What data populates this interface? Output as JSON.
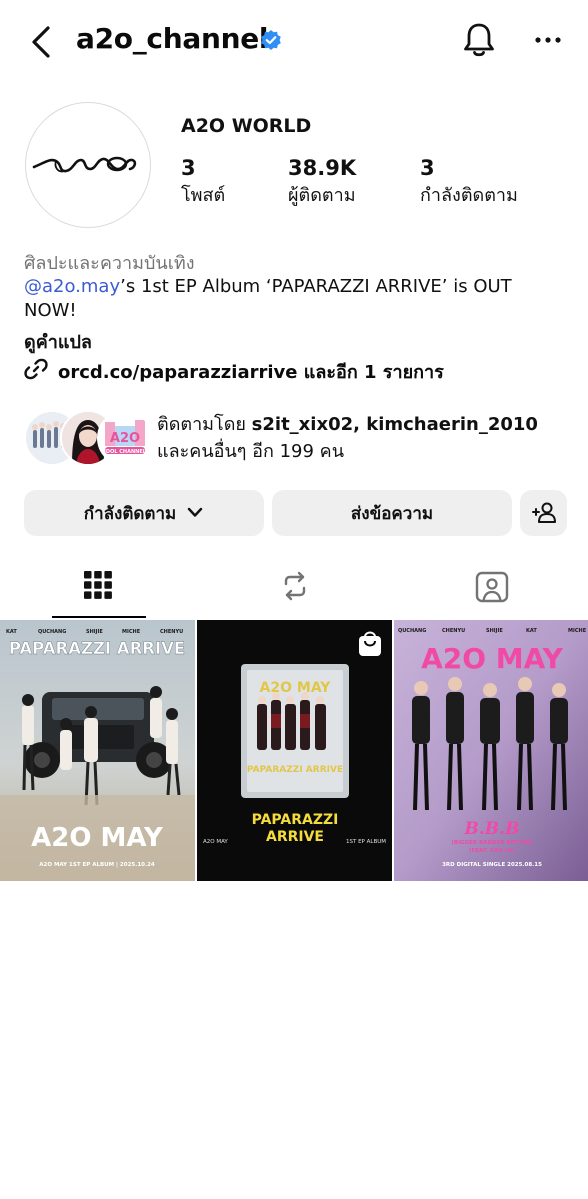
{
  "header": {
    "username": "a2o_channel",
    "back_icon": "chevron-left-icon",
    "verified_icon": "verified-badge-icon",
    "bell_icon": "bell-icon",
    "more_icon": "more-horizontal-icon"
  },
  "profile": {
    "display_name": "A2O WORLD",
    "stats": [
      {
        "value": "3",
        "label": "โพสต์"
      },
      {
        "value": "38.9K",
        "label": "ผู้ติดตาม"
      },
      {
        "value": "3",
        "label": "กำลังติดตาม"
      }
    ],
    "category": "ศิลปะและความบันเทิง",
    "bio_mention": "@a2o.may",
    "bio_text": "’s 1st EP Album ‘PAPARAZZI ARRIVE’ is OUT NOW!",
    "translate": "ดูคำแปล",
    "link": "orcd.co/paparazziarrive และอีก 1 รายการ"
  },
  "followed_by": {
    "prefix": "ติดตามโดย ",
    "names": "s2it_xix02, kimchaerin_2010",
    "suffix": "และคนอื่นๆ อีก 199 คน",
    "avatar_badge": "IDOL CHANNEL"
  },
  "actions": {
    "following_label": "กำลังติดตาม",
    "message_label": "ส่งข้อความ"
  },
  "tabs": {
    "grid_icon": "grid-icon",
    "reels_icon": "repost-icon",
    "tagged_icon": "tagged-user-icon"
  },
  "posts": [
    {
      "names": [
        "KAT",
        "QUCHANG",
        "SHIJIE",
        "MICHE",
        "CHENYU"
      ],
      "headline": "PAPARAZZI ARRIVE",
      "logo": "A2O MAY",
      "footer": "A2O MAY 1ST EP ALBUM  |  2025.10.24"
    },
    {
      "cover_logo": "A2O MAY",
      "cover_title": "PAPARAZZI ARRIVE",
      "headline": "PAPARAZZI ARRIVE",
      "left": "A2O MAY",
      "right": "1ST EP ALBUM",
      "badge_icon": "shopping-bag-icon"
    },
    {
      "names": [
        "QUCHANG",
        "CHENYU",
        "SHIJIE",
        "KAT",
        "MICHE"
      ],
      "logo": "A2O MAY",
      "title": "B.B.B",
      "subtitle": "(BIGGER BADDER BETTER)",
      "feat": "(FEAT. A2O LG)",
      "footer": "3RD DIGITAL SINGLE  2025.08.15"
    }
  ]
}
